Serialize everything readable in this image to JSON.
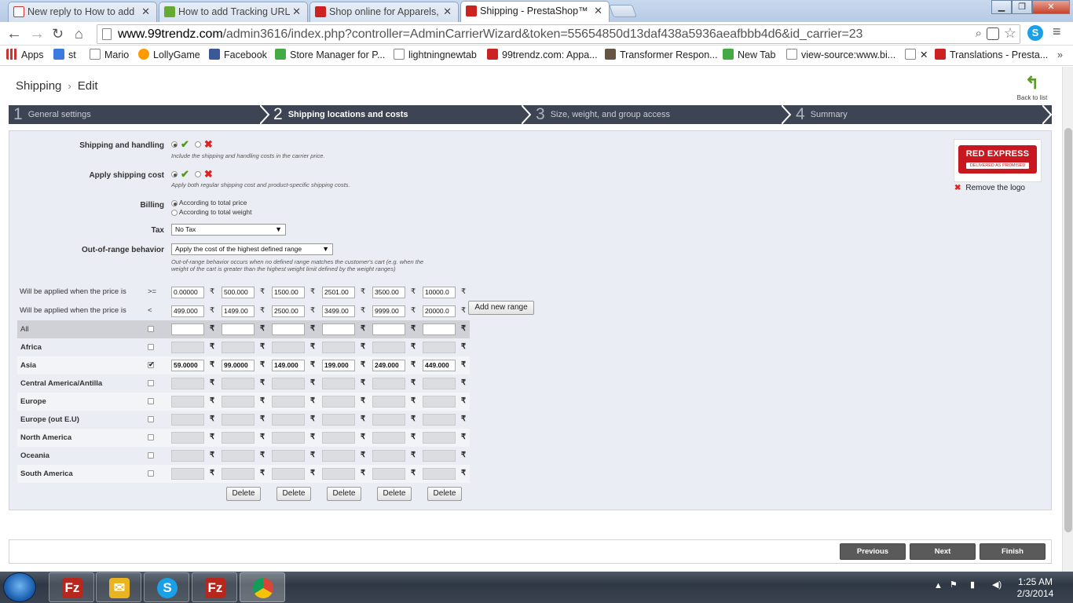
{
  "browser": {
    "tabs": [
      {
        "title": "New reply to How to add",
        "icon": "gmail-icon",
        "color": "#c33"
      },
      {
        "title": "How to add Tracking URL",
        "icon": "prestashop-addons-icon",
        "color": "#6a3"
      },
      {
        "title": "Shop online for Apparels,",
        "icon": "99trendz-icon",
        "color": "#c22"
      },
      {
        "title": "Shipping - PrestaShop™",
        "icon": "99trendz-icon",
        "color": "#c22"
      }
    ],
    "url_host": "www.99trendz.com",
    "url_path": "/admin3616/index.php?controller=AdminCarrierWizard&token=55654850d13daf438a5936aeafbbb4d6&id_carrier=23",
    "bookmarks": [
      "Apps",
      "st",
      "Mario",
      "LollyGame",
      "Facebook",
      "Store Manager for P...",
      "lightningnewtab",
      "99trendz.com: Appa...",
      "Transformer Respon...",
      "New Tab",
      "view-source:www.bi...",
      "",
      "Translations - Presta..."
    ]
  },
  "page": {
    "breadcrumb": [
      "Shipping",
      "Edit"
    ],
    "back_label": "Back to list",
    "steps": [
      {
        "num": "1",
        "label": "General settings"
      },
      {
        "num": "2",
        "label": "Shipping locations and costs"
      },
      {
        "num": "3",
        "label": "Size, weight, and group access"
      },
      {
        "num": "4",
        "label": "Summary"
      }
    ],
    "active_step": 2,
    "form": {
      "shipping_handling_label": "Shipping and handling",
      "shipping_handling_help": "Include the shipping and handling costs in the carrier price.",
      "apply_cost_label": "Apply shipping cost",
      "apply_cost_help": "Apply both regular shipping cost and product-specific shipping costs.",
      "billing_label": "Billing",
      "billing_options": [
        "According to total price",
        "According to total weight"
      ],
      "tax_label": "Tax",
      "tax_value": "No Tax",
      "oor_label": "Out-of-range behavior",
      "oor_value": "Apply the cost of the highest defined range",
      "oor_help_1": "Out-of-range behavior occurs when no defined range matches the customer's cart (e.g. when the",
      "oor_help_2": "weight of the cart is greater than the highest weight limit defined by the weight ranges)"
    },
    "logo_text": "RED EXPRESS",
    "logo_tagline": "DELIVERED AS PROMISED",
    "remove_logo": "Remove the logo",
    "ranges": {
      "label": "Will be applied when the price is",
      "op_from": ">=",
      "op_to": "<",
      "from": [
        "0.00000",
        "500.000",
        "1500.00",
        "2501.00",
        "3500.00",
        "10000.0"
      ],
      "to": [
        "499.000",
        "1499.00",
        "2500.00",
        "3499.00",
        "9999.00",
        "20000.0"
      ],
      "currency": "₹",
      "add_range": "Add new range"
    },
    "zones": [
      {
        "name": "All",
        "checked": false,
        "values": [
          "",
          "",
          "",
          "",
          "",
          ""
        ]
      },
      {
        "name": "Africa",
        "checked": false,
        "values": [
          "",
          "",
          "",
          "",
          "",
          ""
        ]
      },
      {
        "name": "Asia",
        "checked": true,
        "values": [
          "59.0000",
          "99.0000",
          "149.000",
          "199.000",
          "249.000",
          "449.000"
        ]
      },
      {
        "name": "Central America/Antilla",
        "checked": false,
        "values": [
          "",
          "",
          "",
          "",
          "",
          ""
        ]
      },
      {
        "name": "Europe",
        "checked": false,
        "values": [
          "",
          "",
          "",
          "",
          "",
          ""
        ]
      },
      {
        "name": "Europe (out E.U)",
        "checked": false,
        "values": [
          "",
          "",
          "",
          "",
          "",
          ""
        ]
      },
      {
        "name": "North America",
        "checked": false,
        "values": [
          "",
          "",
          "",
          "",
          "",
          ""
        ]
      },
      {
        "name": "Oceania",
        "checked": false,
        "values": [
          "",
          "",
          "",
          "",
          "",
          ""
        ]
      },
      {
        "name": "South America",
        "checked": false,
        "values": [
          "",
          "",
          "",
          "",
          "",
          ""
        ]
      }
    ],
    "delete_label": "Delete",
    "footer": {
      "previous": "Previous",
      "next": "Next",
      "finish": "Finish"
    }
  },
  "taskbar": {
    "time": "1:25 AM",
    "date": "2/3/2014",
    "apps": [
      "filezilla-icon",
      "outlook-icon",
      "skype-icon",
      "filezilla-icon",
      "chrome-icon"
    ]
  }
}
